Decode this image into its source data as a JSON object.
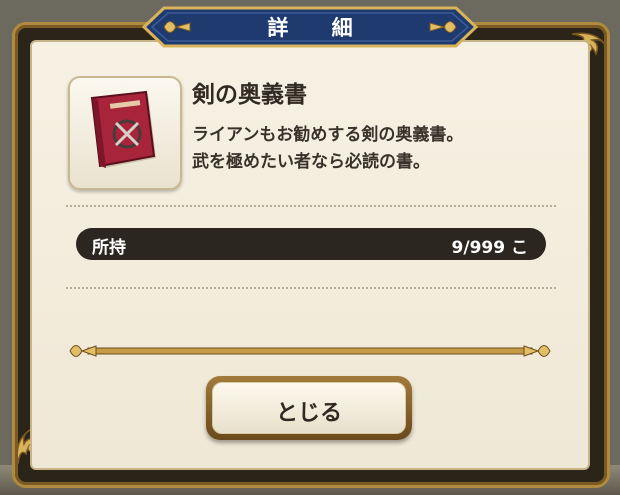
{
  "dialog": {
    "title": "詳 細"
  },
  "item": {
    "name": "剣の奥義書",
    "icon": "red-book-icon",
    "description_lines": [
      "ライアンもお勧めする剣の奥義書。",
      "武を極めたい者なら必読の書。"
    ]
  },
  "owned": {
    "label": "所持",
    "value": "9/999 こ"
  },
  "buttons": {
    "close_label": "とじる"
  },
  "colors": {
    "frame_gold": "#b08a3e",
    "banner_navy": "#1e3a6e",
    "panel_cream": "#f4efe1",
    "dark_bar": "#2b2720",
    "book_red": "#a8243a"
  }
}
